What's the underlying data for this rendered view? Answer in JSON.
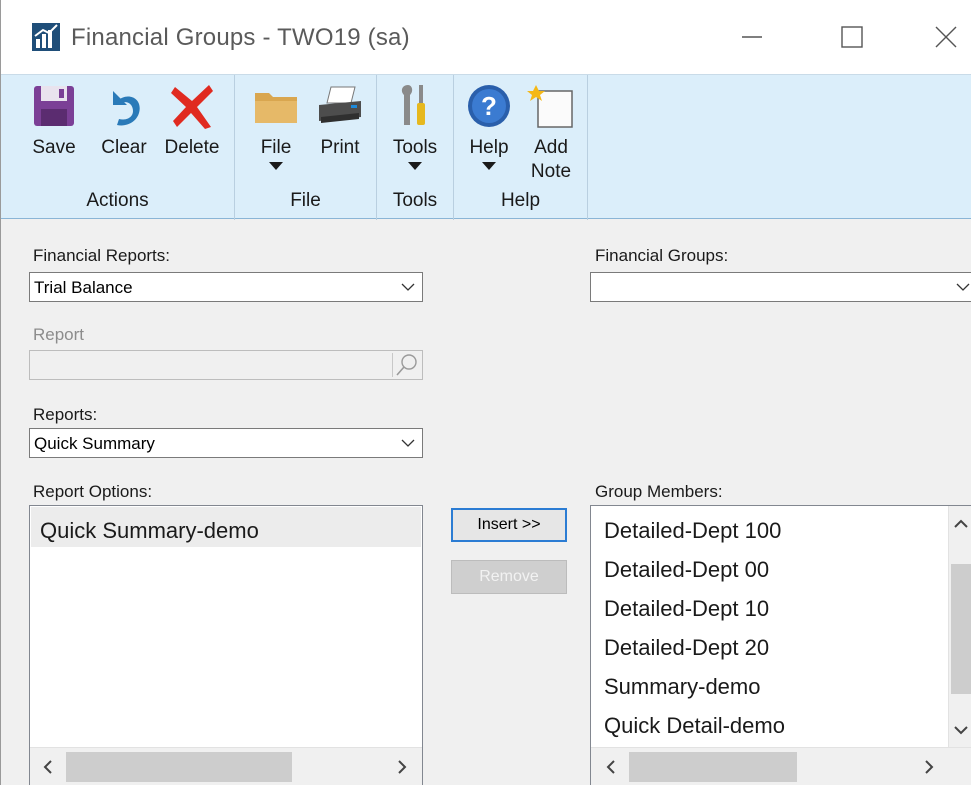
{
  "window": {
    "title": "Financial Groups  -  TWO19 (sa)"
  },
  "ribbon": {
    "groups": [
      {
        "label": "Actions",
        "buttons": [
          {
            "label": "Save",
            "icon": "save-icon"
          },
          {
            "label": "Clear",
            "icon": "undo-icon"
          },
          {
            "label": "Delete",
            "icon": "delete-icon"
          }
        ]
      },
      {
        "label": "File",
        "buttons": [
          {
            "label": "File",
            "icon": "folder-icon",
            "dropdown": true
          },
          {
            "label": "Print",
            "icon": "printer-icon"
          }
        ]
      },
      {
        "label": "Tools",
        "buttons": [
          {
            "label": "Tools",
            "icon": "tools-icon",
            "dropdown": true
          }
        ]
      },
      {
        "label": "Help",
        "buttons": [
          {
            "label": "Help",
            "icon": "help-icon",
            "dropdown": true
          },
          {
            "label": "Add",
            "label2": "Note",
            "icon": "note-icon"
          }
        ]
      }
    ]
  },
  "form": {
    "financial_reports": {
      "label": "Financial Reports:",
      "value": "Trial Balance"
    },
    "financial_groups": {
      "label": "Financial Groups:",
      "value": ""
    },
    "report": {
      "label": "Report",
      "value": ""
    },
    "reports": {
      "label": "Reports:",
      "value": "Quick Summary"
    },
    "report_options": {
      "label": "Report Options:",
      "items": [
        "Quick Summary-demo"
      ]
    },
    "group_members": {
      "label": "Group Members:",
      "items": [
        "Detailed-Dept 100",
        "Detailed-Dept 00",
        "Detailed-Dept 10",
        "Detailed-Dept 20",
        "Summary-demo",
        "Quick Detail-demo"
      ]
    },
    "insert_button": {
      "label": "Insert >>",
      "underline": "I"
    },
    "remove_button": {
      "label": "Remove"
    }
  },
  "colors": {
    "ribbon_bg": "#dbeefa",
    "focus_border": "#2b7cd3",
    "window_bg": "#f0f0f0"
  }
}
